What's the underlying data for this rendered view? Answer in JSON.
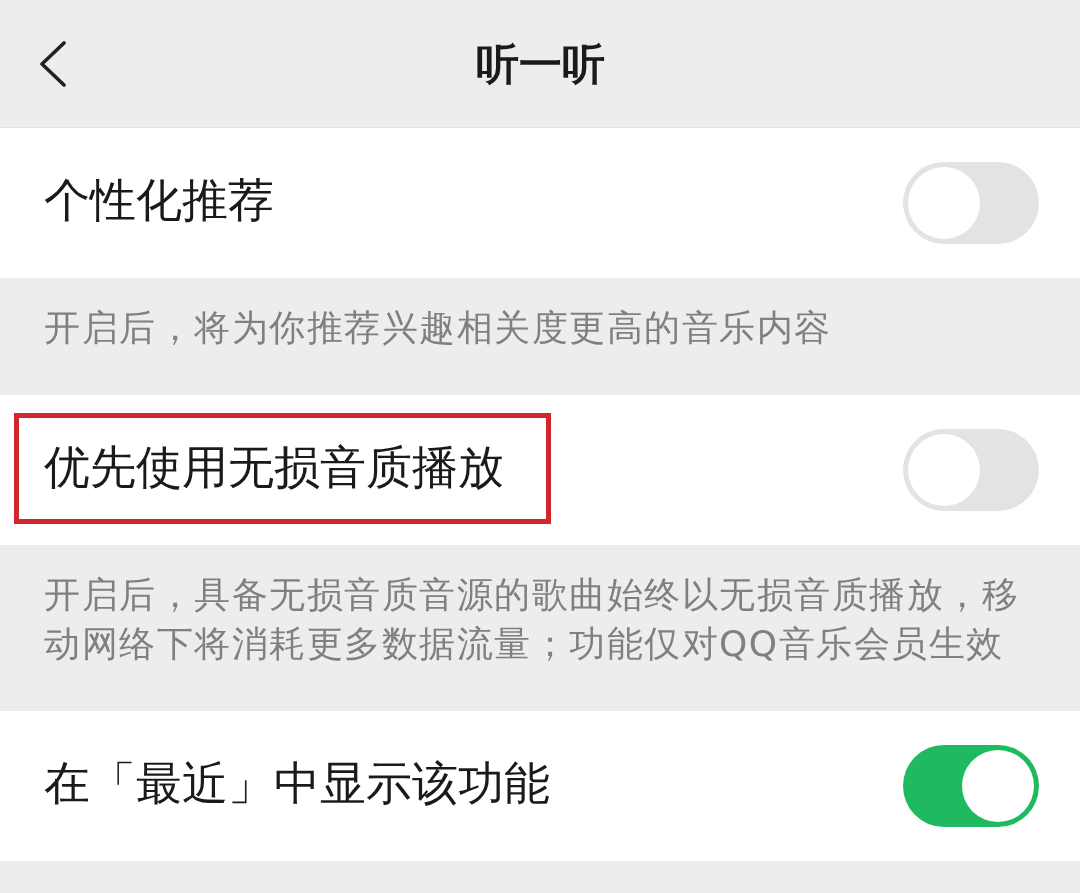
{
  "header": {
    "title": "听一听"
  },
  "settings": [
    {
      "label": "个性化推荐",
      "on": false,
      "highlighted": false,
      "description": "开启后，将为你推荐兴趣相关度更高的音乐内容"
    },
    {
      "label": "优先使用无损音质播放",
      "on": false,
      "highlighted": true,
      "description": "开启后，具备无损音质音源的歌曲始终以无损音质播放，移动网络下将消耗更多数据流量；功能仅对QQ音乐会员生效"
    },
    {
      "label": "在「最近」中显示该功能",
      "on": true,
      "highlighted": false
    }
  ]
}
